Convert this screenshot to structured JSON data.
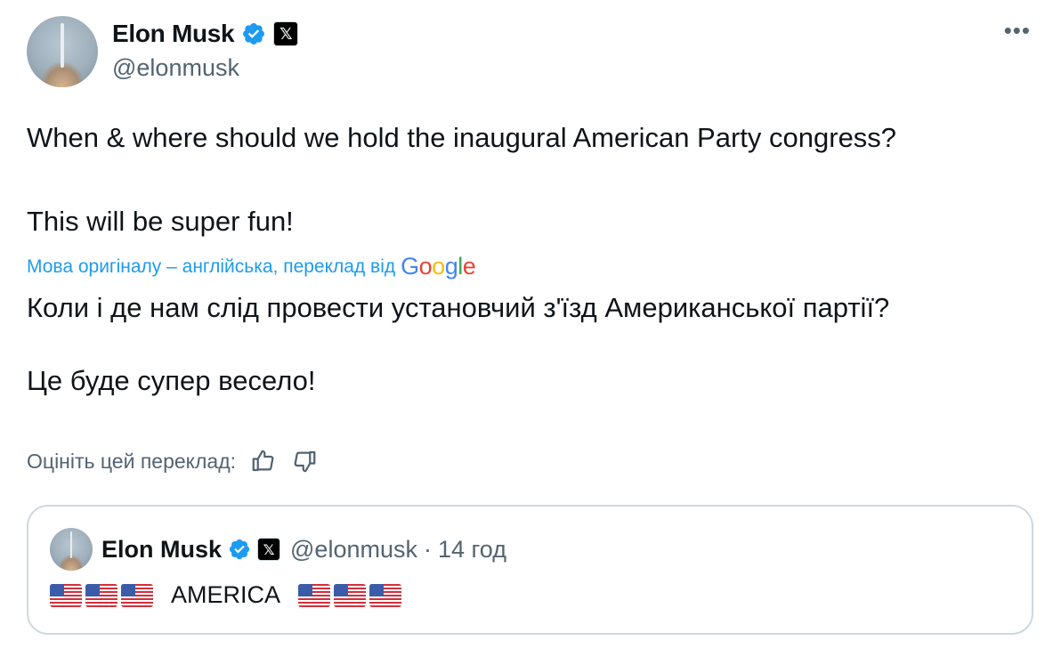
{
  "author": {
    "name": "Elon Musk",
    "handle": "@elonmusk",
    "x_badge": "𝕏",
    "more_label": "•••"
  },
  "tweet": {
    "line1": "When & where should we hold the inaugural American Party congress?",
    "line2": "This will be super fun!"
  },
  "translation": {
    "note": "Мова оригіналу – англійська, переклад від",
    "provider": "Google",
    "line1": "Коли і де нам слід провести установчий з'їзд Американської партії?",
    "line2": "Це буде супер весело!"
  },
  "rating": {
    "label": "Оцініть цей переклад:"
  },
  "quote": {
    "name": "Elon Musk",
    "handle": "@elonmusk",
    "separator": "·",
    "time": "14 год",
    "text": "AMERICA",
    "x_badge": "𝕏"
  },
  "colors": {
    "accent": "#1d9bf0",
    "text": "#0f1419",
    "secondary": "#536471",
    "border": "#cfd9de"
  },
  "icons": [
    "verified-badge-icon",
    "x-logo-icon",
    "more-icon",
    "thumbs-up-icon",
    "thumbs-down-icon",
    "us-flag-icon"
  ]
}
